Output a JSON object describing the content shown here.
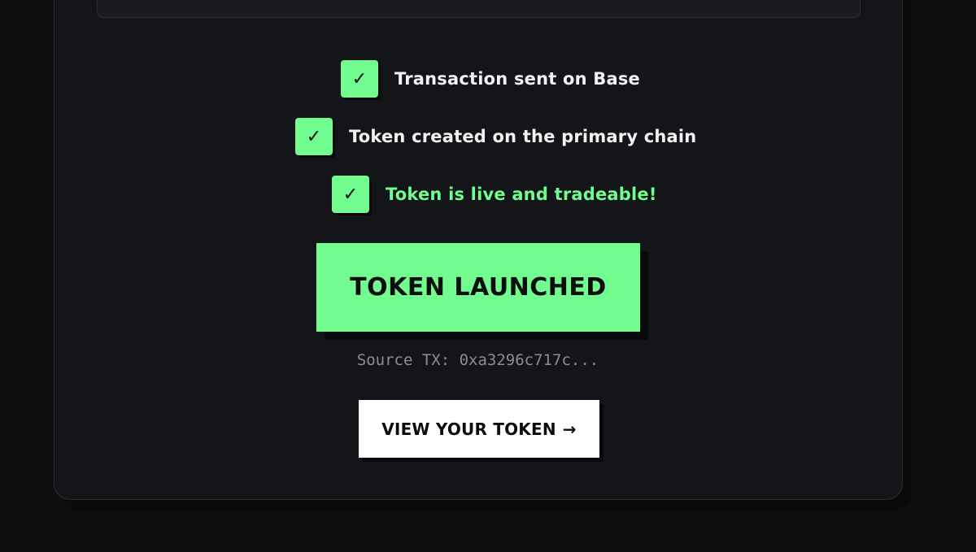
{
  "steps": [
    {
      "label": "Transaction sent on Base",
      "check": "✓",
      "status": "done"
    },
    {
      "label": "Token created on the primary chain",
      "check": "✓",
      "status": "done"
    },
    {
      "label": "Token is live and tradeable!",
      "check": "✓",
      "status": "success"
    }
  ],
  "launch": {
    "label": "TOKEN LAUNCHED"
  },
  "source_tx": {
    "text": "Source TX: 0xa3296c717c..."
  },
  "view_token": {
    "label": "VIEW YOUR TOKEN",
    "arrow": "→"
  },
  "colors": {
    "accent": "#72fb8e",
    "background": "#0e0e10",
    "card": "#141518",
    "text": "#f2f2f2",
    "muted": "#8b8d96"
  }
}
